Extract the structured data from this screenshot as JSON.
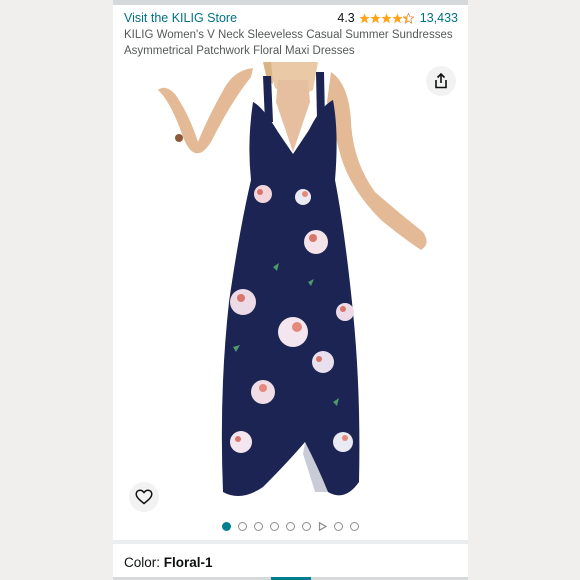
{
  "store": {
    "link_label": "Visit the KILIG Store"
  },
  "rating": {
    "value": "4.3",
    "stars": 4.3,
    "reviews": "13,433"
  },
  "product": {
    "title": "KILIG Women's V Neck Sleeveless Casual Summer Sundresses Asymmetrical Patchwork Floral Maxi Dresses"
  },
  "gallery": {
    "share_icon": "share-icon",
    "wishlist_icon": "heart-icon",
    "image_alt": "product-photo-dress",
    "dots_count": 9,
    "active_index": 0,
    "video_index": 6
  },
  "variant": {
    "label": "Color: ",
    "value": "Floral-1"
  },
  "colors": {
    "link": "#007185",
    "accent": "#00808f",
    "star": "#ffa41c",
    "dress": "#1b2452"
  }
}
